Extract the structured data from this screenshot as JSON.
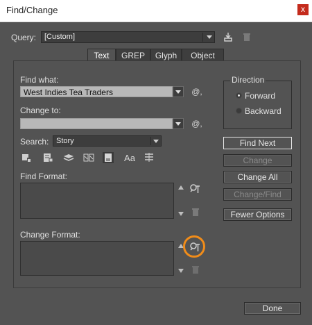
{
  "window": {
    "title": "Find/Change",
    "close_glyph": "x"
  },
  "query": {
    "label": "Query:",
    "value": "[Custom]"
  },
  "tabs": [
    {
      "label": "Text",
      "active": true
    },
    {
      "label": "GREP",
      "active": false
    },
    {
      "label": "Glyph",
      "active": false
    },
    {
      "label": "Object",
      "active": false
    }
  ],
  "find": {
    "label": "Find what:",
    "value": "West Indies Tea Traders",
    "special_glyph": "@,"
  },
  "change": {
    "label": "Change to:",
    "value": "",
    "special_glyph": "@,"
  },
  "search": {
    "label": "Search:",
    "value": "Story"
  },
  "options": {
    "icons": [
      "include-locked-layers-icon",
      "include-locked-stories-icon",
      "include-hidden-layers-icon",
      "include-master-pages-icon",
      "include-footnotes-icon",
      "case-sensitive-icon",
      "whole-word-icon"
    ],
    "case_label": "Aa"
  },
  "direction": {
    "label": "Direction",
    "options": [
      {
        "label": "Forward",
        "selected": true
      },
      {
        "label": "Backward",
        "selected": false
      }
    ]
  },
  "buttons": {
    "find_next": "Find Next",
    "change": "Change",
    "change_all": "Change All",
    "change_find": "Change/Find",
    "fewer_options": "Fewer Options",
    "done": "Done"
  },
  "find_format": {
    "label": "Find Format:"
  },
  "change_format": {
    "label": "Change Format:"
  },
  "colors": {
    "highlight_ring": "#f08c1a",
    "close_button": "#c42b1c"
  }
}
